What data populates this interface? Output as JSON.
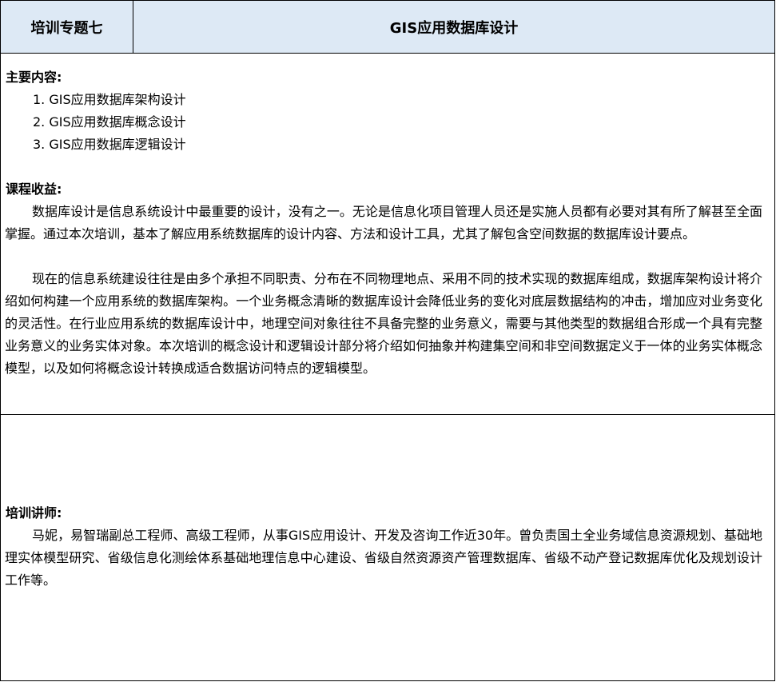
{
  "header": {
    "label": "培训专题七",
    "title": "GIS应用数据库设计"
  },
  "main_content": {
    "heading": "主要内容:",
    "items": [
      "1. GIS应用数据库架构设计",
      "2. GIS应用数据库概念设计",
      "3. GIS应用数据库逻辑设计"
    ]
  },
  "benefits": {
    "heading": "课程收益:",
    "paragraphs": [
      "数据库设计是信息系统设计中最重要的设计，没有之一。无论是信息化项目管理人员还是实施人员都有必要对其有所了解甚至全面掌握。通过本次培训，基本了解应用系统数据库的设计内容、方法和设计工具，尤其了解包含空间数据的数据库设计要点。",
      "现在的信息系统建设往往是由多个承担不同职责、分布在不同物理地点、采用不同的技术实现的数据库组成，数据库架构设计将介绍如何构建一个应用系统的数据库架构。一个业务概念清晰的数据库设计会降低业务的变化对底层数据结构的冲击，增加应对业务变化的灵活性。在行业应用系统的数据库设计中，地理空间对象往往不具备完整的业务意义，需要与其他类型的数据组合形成一个具有完整业务意义的业务实体对象。本次培训的概念设计和逻辑设计部分将介绍如何抽象并构建集空间和非空间数据定义于一体的业务实体概念模型，以及如何将概念设计转换成适合数据访问特点的逻辑模型。"
    ]
  },
  "lecturer": {
    "heading": "培训讲师:",
    "bio": "马妮，易智瑞副总工程师、高级工程师，从事GIS应用设计、开发及咨询工作近30年。曾负责国土全业务域信息资源规划、基础地理实体模型研究、省级信息化测绘体系基础地理信息中心建设、省级自然资源资产管理数据库、省级不动产登记数据库优化及规划设计工作等。"
  },
  "colors": {
    "header_background": "#dde9f5",
    "border": "#000000",
    "text": "#000000"
  }
}
